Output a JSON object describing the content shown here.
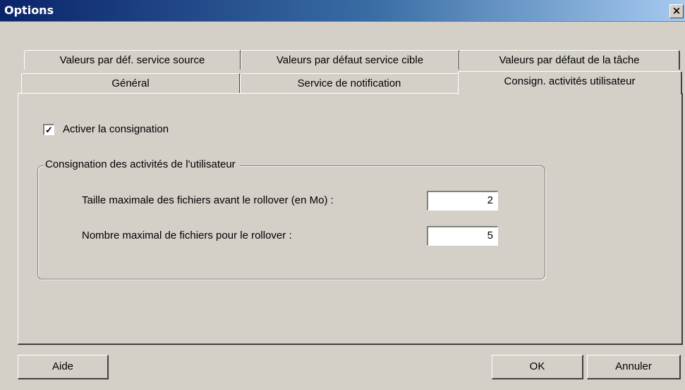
{
  "window": {
    "title": "Options",
    "close_label": "×"
  },
  "tabs": {
    "row1": [
      "Valeurs par déf. service source",
      "Valeurs par défaut service cible",
      "Valeurs par défaut de la tâche"
    ],
    "row2": [
      "Général",
      "Service de notification",
      "Consign. activités utilisateur"
    ],
    "active": "Consign. activités utilisateur"
  },
  "logging": {
    "enable_label": "Activer la consignation",
    "enable_checked": true,
    "group_title": "Consignation des activités de l'utilisateur",
    "max_size_label": "Taille maximale des fichiers avant le rollover (en Mo) :",
    "max_size_value": "2",
    "max_files_label": "Nombre maximal de fichiers pour le rollover :",
    "max_files_value": "5"
  },
  "buttons": {
    "help": "Aide",
    "ok": "OK",
    "cancel": "Annuler"
  }
}
